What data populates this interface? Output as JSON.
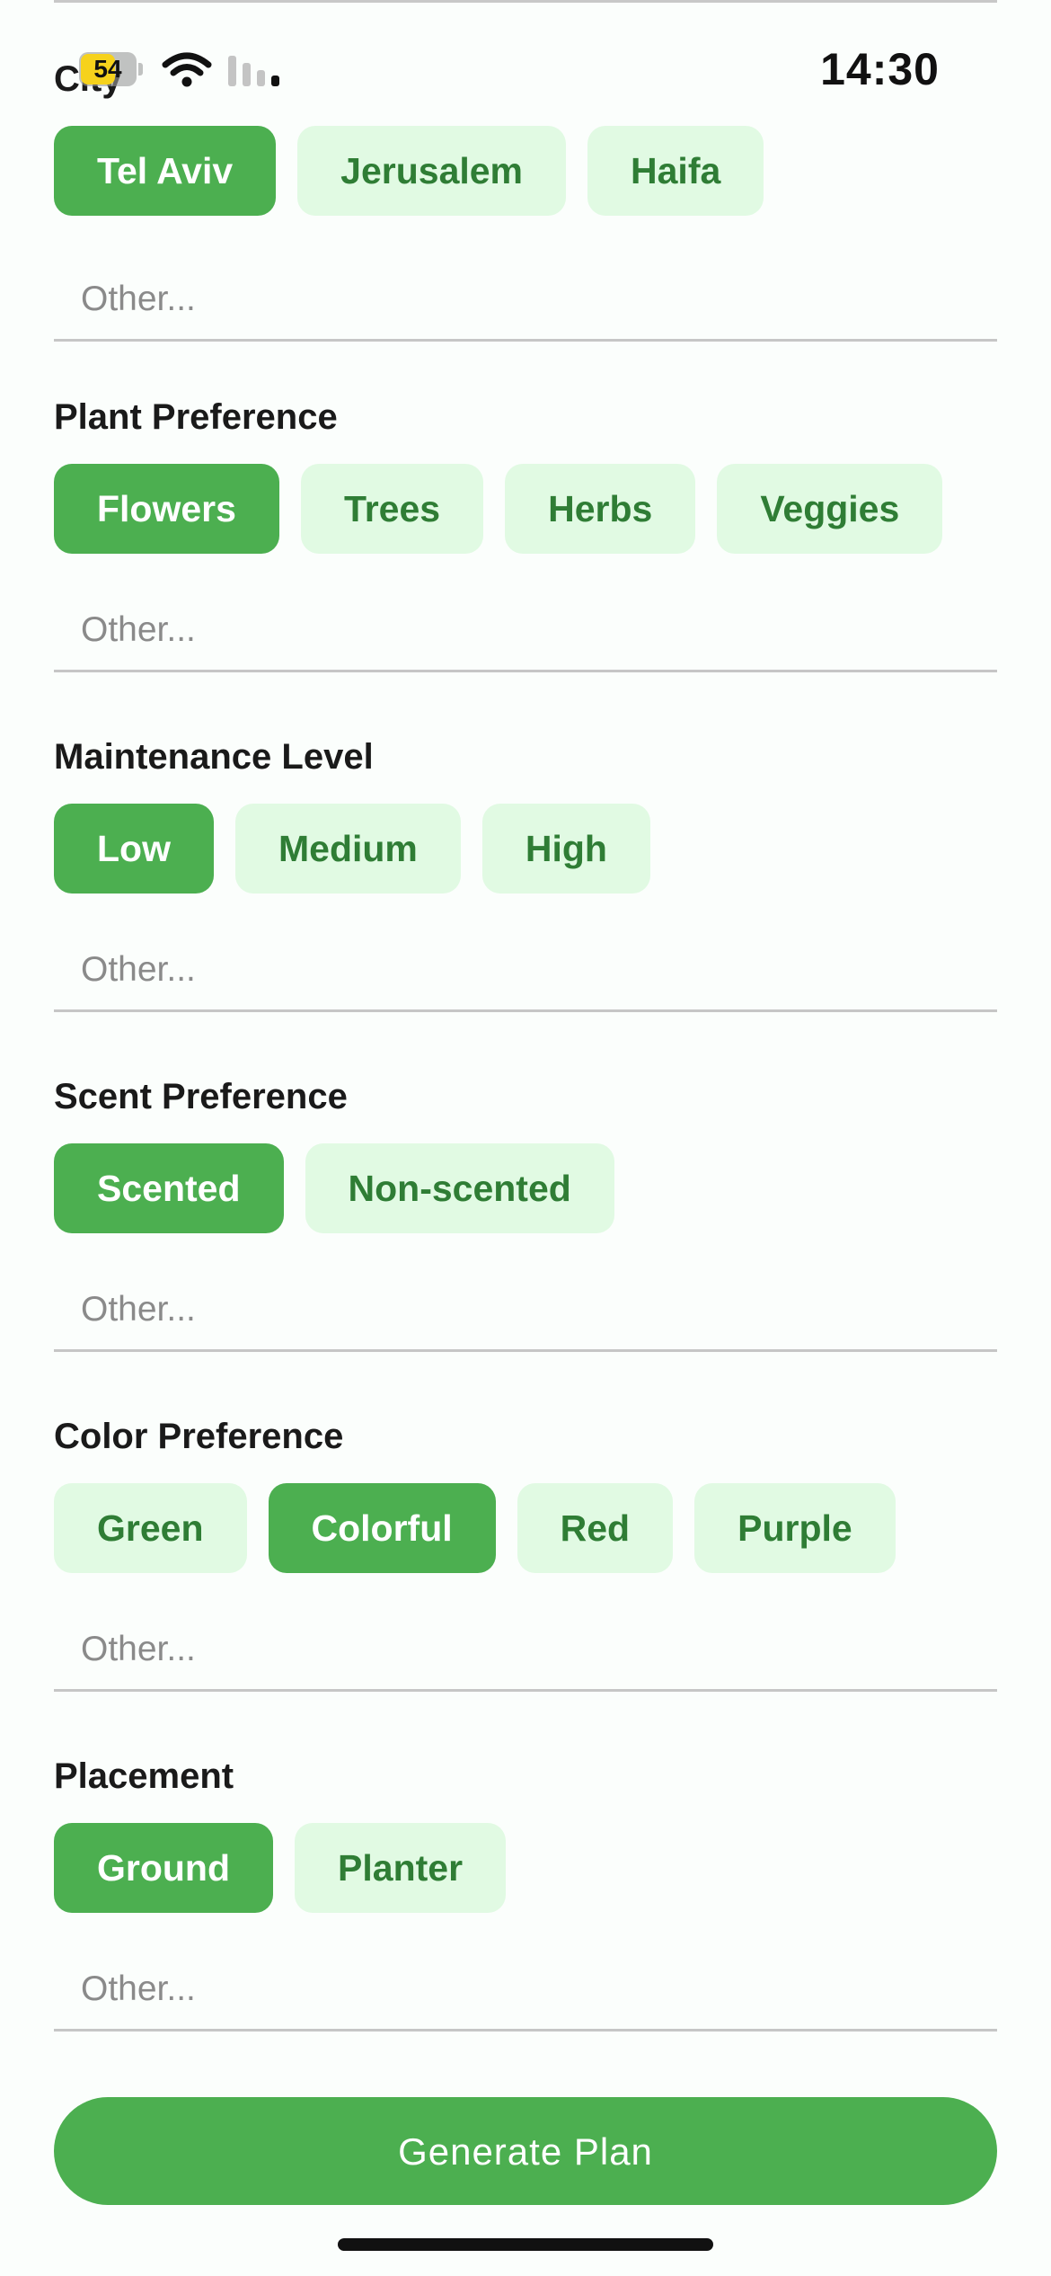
{
  "status_bar": {
    "battery_level": "54",
    "time": "14:30",
    "battery_color": "#f6d21c"
  },
  "colors": {
    "accent": "#4caf50",
    "chip_background": "#e1fae3",
    "chip_text": "#2f7d35"
  },
  "sections": [
    {
      "title": "City",
      "options": [
        "Tel Aviv",
        "Jerusalem",
        "Haifa"
      ],
      "selected": "Tel Aviv",
      "other_placeholder": "Other..."
    },
    {
      "title": "Plant Preference",
      "options": [
        "Flowers",
        "Trees",
        "Herbs",
        "Veggies"
      ],
      "selected": "Flowers",
      "other_placeholder": "Other..."
    },
    {
      "title": "Maintenance Level",
      "options": [
        "Low",
        "Medium",
        "High"
      ],
      "selected": "Low",
      "other_placeholder": "Other..."
    },
    {
      "title": "Scent Preference",
      "options": [
        "Scented",
        "Non-scented"
      ],
      "selected": "Scented",
      "other_placeholder": "Other..."
    },
    {
      "title": "Color Preference",
      "options": [
        "Green",
        "Colorful",
        "Red",
        "Purple"
      ],
      "selected": "Colorful",
      "other_placeholder": "Other..."
    },
    {
      "title": "Placement",
      "options": [
        "Ground",
        "Planter"
      ],
      "selected": "Ground",
      "other_placeholder": "Other..."
    }
  ],
  "actions": {
    "generate_label": "Generate Plan"
  },
  "icons": [
    "battery-icon",
    "wifi-icon",
    "cellular-signal-icon"
  ]
}
